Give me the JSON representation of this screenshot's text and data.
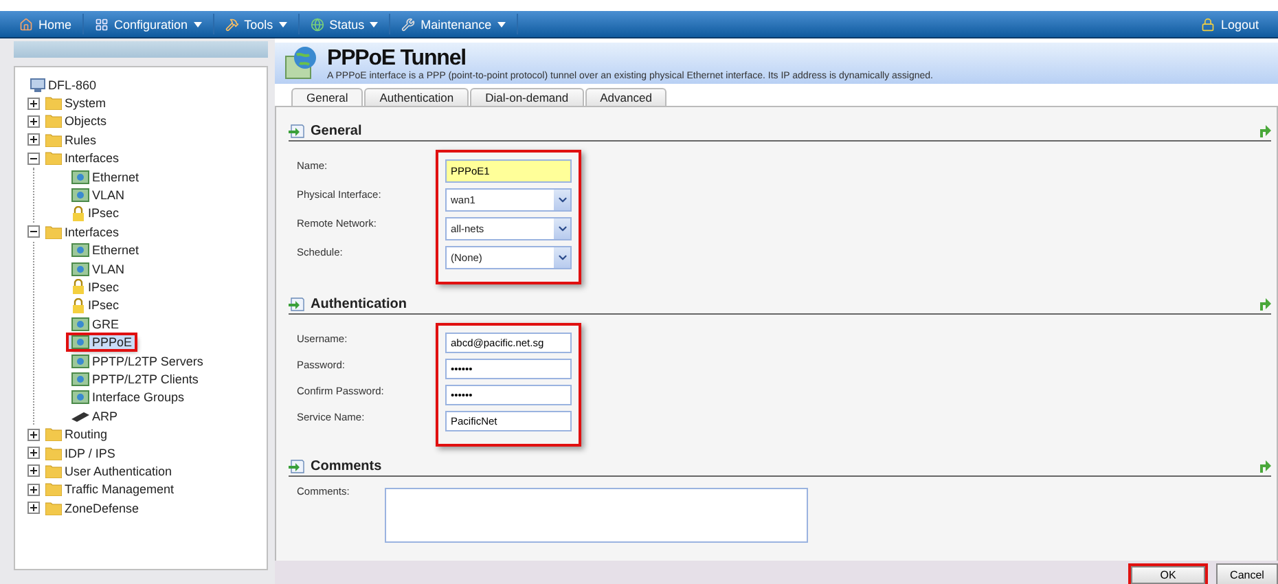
{
  "nav": {
    "items": [
      {
        "label": "Home",
        "menu": false
      },
      {
        "label": "Configuration",
        "menu": true
      },
      {
        "label": "Tools",
        "menu": true
      },
      {
        "label": "Status",
        "menu": true
      },
      {
        "label": "Maintenance",
        "menu": true
      }
    ],
    "logout": "Logout"
  },
  "tree": [
    {
      "label": "DFL-860",
      "kind": "root",
      "selected": false,
      "highlighted": false,
      "children": [
        {
          "label": "System",
          "kind": "folder",
          "expanded": false,
          "selected": false,
          "highlighted": false
        },
        {
          "label": "Objects",
          "kind": "folder",
          "expanded": false,
          "selected": false,
          "highlighted": false
        },
        {
          "label": "Rules",
          "kind": "folder",
          "expanded": false,
          "selected": false,
          "highlighted": false
        },
        {
          "label": "Interfaces",
          "kind": "folder",
          "expanded": true,
          "selected": false,
          "highlighted": false,
          "children": [
            {
              "label": "Ethernet",
              "kind": "leaf",
              "selected": false,
              "highlighted": false
            },
            {
              "label": "VLAN",
              "kind": "leaf",
              "selected": false,
              "highlighted": false
            },
            {
              "label": "IPsec",
              "kind": "lock",
              "selected": false,
              "highlighted": false
            }
          ]
        },
        {
          "label": "Interfaces",
          "kind": "folder",
          "expanded": true,
          "selected": false,
          "highlighted": false,
          "children": [
            {
              "label": "Ethernet",
              "kind": "leaf",
              "selected": false,
              "highlighted": false
            },
            {
              "label": "VLAN",
              "kind": "leaf",
              "selected": false,
              "highlighted": false
            },
            {
              "label": "IPsec",
              "kind": "lock",
              "selected": false,
              "highlighted": false
            },
            {
              "label": "IPsec",
              "kind": "lock",
              "selected": false,
              "highlighted": false
            },
            {
              "label": "GRE",
              "kind": "leaf",
              "selected": false,
              "highlighted": false
            },
            {
              "label": "PPPoE",
              "kind": "leaf",
              "selected": true,
              "highlighted": true
            },
            {
              "label": "PPTP/L2TP Servers",
              "kind": "leaf",
              "selected": false,
              "highlighted": false
            },
            {
              "label": "PPTP/L2TP Clients",
              "kind": "leaf",
              "selected": false,
              "highlighted": false
            },
            {
              "label": "Interface Groups",
              "kind": "leaf",
              "selected": false,
              "highlighted": false
            },
            {
              "label": "ARP",
              "kind": "cable",
              "selected": false,
              "highlighted": false
            }
          ]
        },
        {
          "label": "Routing",
          "kind": "folder",
          "expanded": false,
          "selected": false,
          "highlighted": false
        },
        {
          "label": "IDP / IPS",
          "kind": "folder",
          "expanded": false,
          "selected": false,
          "highlighted": false
        },
        {
          "label": "User Authentication",
          "kind": "folder",
          "expanded": false,
          "selected": false,
          "highlighted": false
        },
        {
          "label": "Traffic Management",
          "kind": "folder",
          "expanded": false,
          "selected": false,
          "highlighted": false
        },
        {
          "label": "ZoneDefense",
          "kind": "folder",
          "expanded": false,
          "selected": false,
          "highlighted": false
        }
      ]
    }
  ],
  "header": {
    "title": "PPPoE Tunnel",
    "description": "A PPPoE interface is a PPP (point-to-point protocol) tunnel over an existing physical Ethernet interface. Its IP address is dynamically assigned."
  },
  "tabs": [
    {
      "label": "General",
      "selected": true
    },
    {
      "label": "Authentication",
      "selected": false
    },
    {
      "label": "Dial-on-demand",
      "selected": false
    },
    {
      "label": "Advanced",
      "selected": false
    }
  ],
  "sections": [
    {
      "title": "General",
      "highlighted": true,
      "fields": [
        {
          "label": "Name:",
          "kind": "required",
          "value": "PPPoE1"
        },
        {
          "label": "Physical Interface:",
          "kind": "select",
          "value": "wan1"
        },
        {
          "label": "Remote Network:",
          "kind": "select",
          "value": "all-nets"
        },
        {
          "label": "Schedule:",
          "kind": "select",
          "value": "(None)"
        }
      ]
    },
    {
      "title": "Authentication",
      "highlighted": true,
      "fields": [
        {
          "label": "Username:",
          "kind": "text",
          "value": "abcd@pacific.net.sg"
        },
        {
          "label": "Password:",
          "kind": "password",
          "value": "••••••"
        },
        {
          "label": "Confirm Password:",
          "kind": "password",
          "value": "••••••"
        },
        {
          "label": "Service Name:",
          "kind": "text",
          "value": "PacificNet"
        }
      ]
    },
    {
      "title": "Comments",
      "highlighted": false,
      "fields": [
        {
          "label": "Comments:",
          "kind": "textarea"
        }
      ]
    }
  ],
  "buttons": [
    {
      "label": "OK",
      "highlighted": true
    },
    {
      "label": "Cancel",
      "highlighted": false
    }
  ]
}
